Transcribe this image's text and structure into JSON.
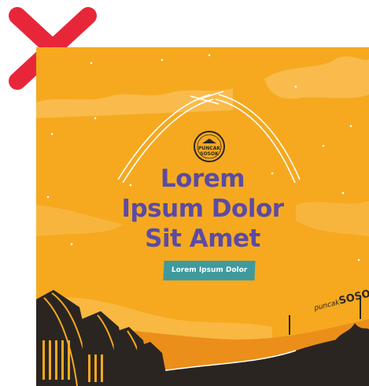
{
  "reject_mark": {
    "icon": "close-icon",
    "color": "#e8263a"
  },
  "poster": {
    "background": "#f6a91f",
    "headline_lines": [
      "Lorem",
      "Ipsum Dolor",
      "Sit Amet"
    ],
    "headline_color": "#5b4ba4",
    "tag_label": "Lorem Ipsum Dolor",
    "tag_color": "#3f9a9e",
    "logo": {
      "icon": "puncak-sosok-logo-icon",
      "text_top": "PUNCAK",
      "text_bottom": "SOSOK"
    },
    "sign": {
      "small": "puncak",
      "big": "SOSOK"
    }
  }
}
